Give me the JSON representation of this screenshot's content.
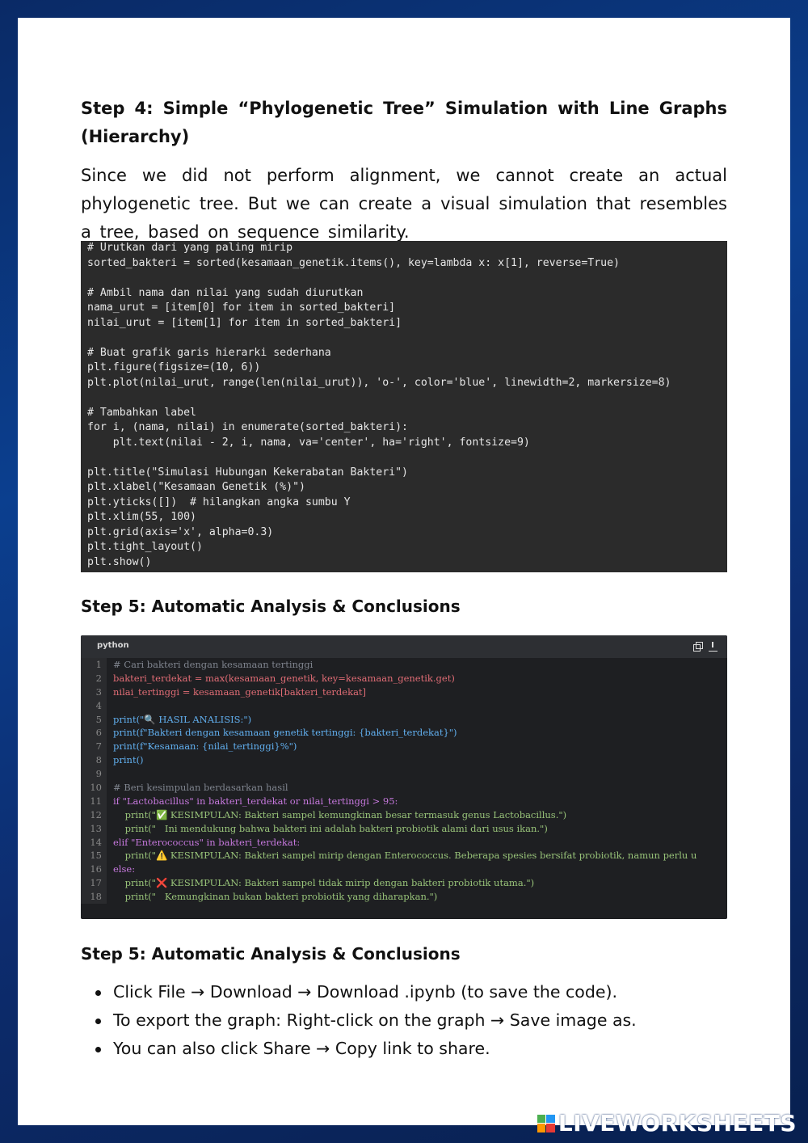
{
  "step4": {
    "heading": "Step 4: Simple “Phylogenetic Tree” Simulation with Line Graphs (Hierarchy)",
    "paragraph": "Since we did not perform alignment, we cannot create an actual phylogenetic tree. But we can create a visual simulation that resembles a tree, based on sequence similarity."
  },
  "code1": {
    "lines": [
      "# Urutkan dari yang paling mirip",
      "sorted_bakteri = sorted(kesamaan_genetik.items(), key=lambda x: x[1], reverse=True)",
      "",
      "# Ambil nama dan nilai yang sudah diurutkan",
      "nama_urut = [item[0] for item in sorted_bakteri]",
      "nilai_urut = [item[1] for item in sorted_bakteri]",
      "",
      "# Buat grafik garis hierarki sederhana",
      "plt.figure(figsize=(10, 6))",
      "plt.plot(nilai_urut, range(len(nilai_urut)), 'o-', color='blue', linewidth=2, markersize=8)",
      "",
      "# Tambahkan label",
      "for i, (nama, nilai) in enumerate(sorted_bakteri):",
      "    plt.text(nilai - 2, i, nama, va='center', ha='right', fontsize=9)",
      "",
      "plt.title(\"Simulasi Hubungan Kekerabatan Bakteri\")",
      "plt.xlabel(\"Kesamaan Genetik (%)\")",
      "plt.yticks([])  # hilangkan angka sumbu Y",
      "plt.xlim(55, 100)",
      "plt.grid(axis='x', alpha=0.3)",
      "plt.tight_layout()",
      "plt.show()"
    ]
  },
  "step5a": {
    "heading": "Step 5: Automatic Analysis & Conclusions"
  },
  "code2": {
    "language": "python",
    "line_numbers": [
      "1",
      "2",
      "3",
      "4",
      "5",
      "6",
      "7",
      "8",
      "9",
      "10",
      "11",
      "12",
      "13",
      "14",
      "15",
      "16",
      "17",
      "18"
    ],
    "lines": [
      "# Cari bakteri dengan kesamaan tertinggi",
      "bakteri_terdekat = max(kesamaan_genetik, key=kesamaan_genetik.get)",
      "nilai_tertinggi = kesamaan_genetik[bakteri_terdekat]",
      "",
      "print(\"🔍 HASIL ANALISIS:\")",
      "print(f\"Bakteri dengan kesamaan genetik tertinggi: {bakteri_terdekat}\")",
      "print(f\"Kesamaan: {nilai_tertinggi}%\")",
      "print()",
      "",
      "# Beri kesimpulan berdasarkan hasil",
      "if \"Lactobacillus\" in bakteri_terdekat or nilai_tertinggi > 95:",
      "    print(\"✅ KESIMPULAN: Bakteri sampel kemungkinan besar termasuk genus Lactobacillus.\")",
      "    print(\"   Ini mendukung bahwa bakteri ini adalah bakteri probiotik alami dari usus ikan.\")",
      "elif \"Enterococcus\" in bakteri_terdekat:",
      "    print(\"⚠️ KESIMPULAN: Bakteri sampel mirip dengan Enterococcus. Beberapa spesies bersifat probiotik, namun perlu u",
      "else:",
      "    print(\"❌ KESIMPULAN: Bakteri sampel tidak mirip dengan bakteri probiotik utama.\")",
      "    print(\"   Kemungkinan bukan bakteri probiotik yang diharapkan.\")"
    ],
    "copy_icon": "copy-icon",
    "download_icon": "download-icon"
  },
  "step5b": {
    "heading": "Step 5: Automatic Analysis & Conclusions",
    "bullets": [
      "Click File → Download → Download .ipynb (to save the code).",
      "To export the graph: Right-click on the graph → Save image as.",
      "You can also click Share → Copy link to share."
    ]
  },
  "brand": {
    "name": "LIVEWORKSHEETS",
    "logo_colors": [
      "#4caf50",
      "#2196f3",
      "#ff9800",
      "#e53935"
    ]
  }
}
